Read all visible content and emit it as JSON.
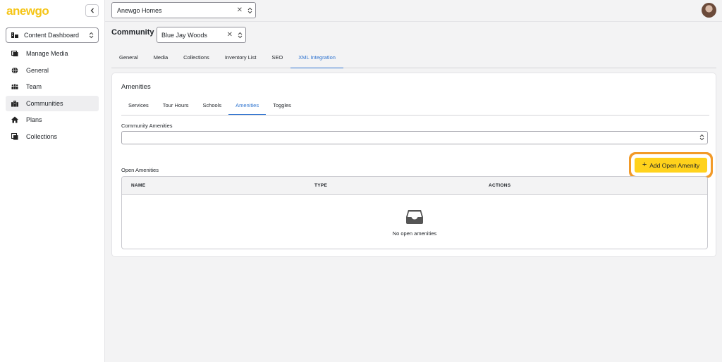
{
  "app": {
    "logo": "anewgo"
  },
  "sidebar": {
    "dashboard_select": "Content Dashboard",
    "items": [
      {
        "label": "Manage Media",
        "icon": "media-icon"
      },
      {
        "label": "General",
        "icon": "globe-icon"
      },
      {
        "label": "Team",
        "icon": "team-icon"
      },
      {
        "label": "Communities",
        "icon": "building-icon",
        "active": true
      },
      {
        "label": "Plans",
        "icon": "home-icon"
      },
      {
        "label": "Collections",
        "icon": "collections-icon"
      }
    ]
  },
  "header": {
    "org_select": "Anewgo Homes"
  },
  "community": {
    "title": "Community",
    "select": "Blue Jay Woods",
    "tabs": [
      "General",
      "Media",
      "Collections",
      "Inventory List",
      "SEO",
      "XML Integration"
    ],
    "active_tab": "XML Integration"
  },
  "card": {
    "title": "Amenities",
    "subtabs": [
      "Services",
      "Tour Hours",
      "Schools",
      "Amenities",
      "Toggles"
    ],
    "active_subtab": "Amenities",
    "community_amenities_label": "Community Amenities",
    "open_amenities_label": "Open Amenities",
    "add_button_label": "Add Open Amenity",
    "table": {
      "columns": [
        "NAME",
        "TYPE",
        "ACTIONS"
      ],
      "empty_text": "No open amenities"
    }
  },
  "colors": {
    "accent": "#2f74d0",
    "brand_yellow": "#ffd21c",
    "highlight": "#f29a28"
  }
}
